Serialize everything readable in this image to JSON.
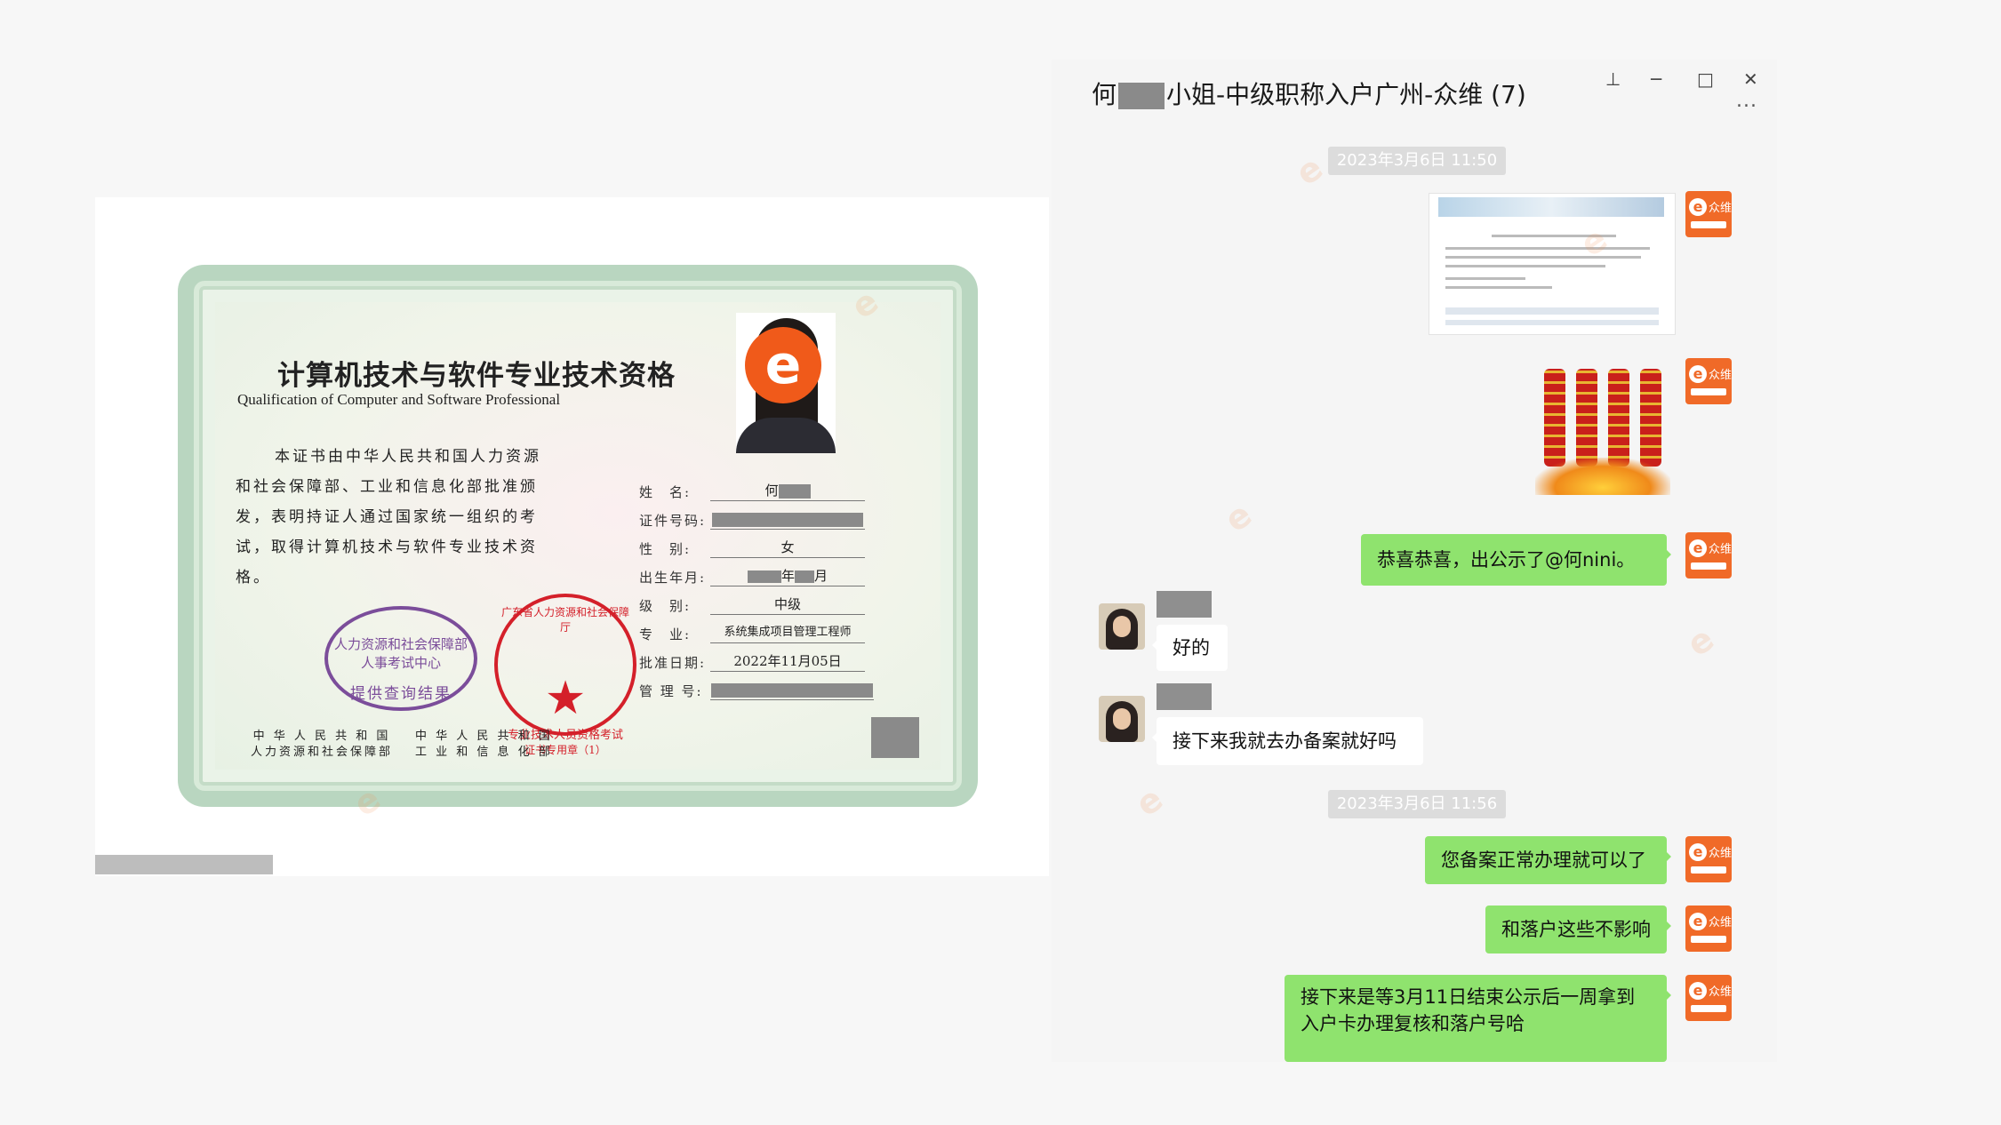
{
  "certificate": {
    "title": "计算机技术与软件专业技术资格",
    "subtitle": "Qualification of Computer and Software Professional",
    "body": "本证书由中华人民共和国人力资源和社会保障部、工业和信息化部批准颁发，表明持证人通过国家统一组织的考试，取得计算机技术与软件专业技术资格。",
    "fields": {
      "name_label": "姓　名:",
      "name_value": "何",
      "id_label": "证件号码:",
      "gender_label": "性　别:",
      "gender_value": "女",
      "birth_label": "出生年月:",
      "birth_year_suffix": "年",
      "birth_month_suffix": "月",
      "level_label": "级　别:",
      "level_value": "中级",
      "major_label": "专　业:",
      "major_value": "系统集成项目管理工程师",
      "approval_label": "批准日期:",
      "approval_value": "2022年11月05日",
      "mgmt_label": "管 理 号:"
    },
    "seal_purple": {
      "line1": "人力资源和社会保障部人事考试中心",
      "line2": "提供查询结果"
    },
    "seal_red": {
      "line1": "广东省人力资源和社会保障厅",
      "line2": "专业技术人员资格考试",
      "line3": "证书专用章（1）"
    },
    "issuer_left": [
      "中 华 人 民 共 和 国",
      "人力资源和社会保障部"
    ],
    "issuer_right": [
      "中 华 人 民 共 和 国",
      "工 业 和 信 息 化 部"
    ]
  },
  "chat": {
    "title_prefix": "何",
    "title_suffix": "小姐-中级职称入户广州-众维 (7)",
    "controls": {
      "pin": "⊥",
      "minimize": "─",
      "maximize": "□",
      "close": "✕"
    },
    "more_label": "...",
    "timestamps": [
      "2023年3月6日 11:50",
      "2023年3月6日 11:56"
    ],
    "brand_avatar_text": "众维",
    "messages": {
      "m1": "恭喜恭喜，出公示了@何nini。",
      "m2": "好的",
      "m3": "接下来我就去办备案就好吗",
      "m4": "您备案正常办理就可以了",
      "m5": "和落户这些不影响",
      "m6_line1": "接下来是等3月11日结束公示后一周拿到",
      "m6_line2": "入户卡办理复核和落户号哈"
    }
  },
  "colors": {
    "bubble_out": "#8fe36e",
    "bubble_in": "#ffffff",
    "brand": "#f06a28",
    "seal_red": "#d4202a",
    "seal_purple": "#7b4d9a"
  },
  "icons": [
    "pin-icon",
    "minimize-icon",
    "maximize-icon",
    "close-icon",
    "more-icon"
  ]
}
